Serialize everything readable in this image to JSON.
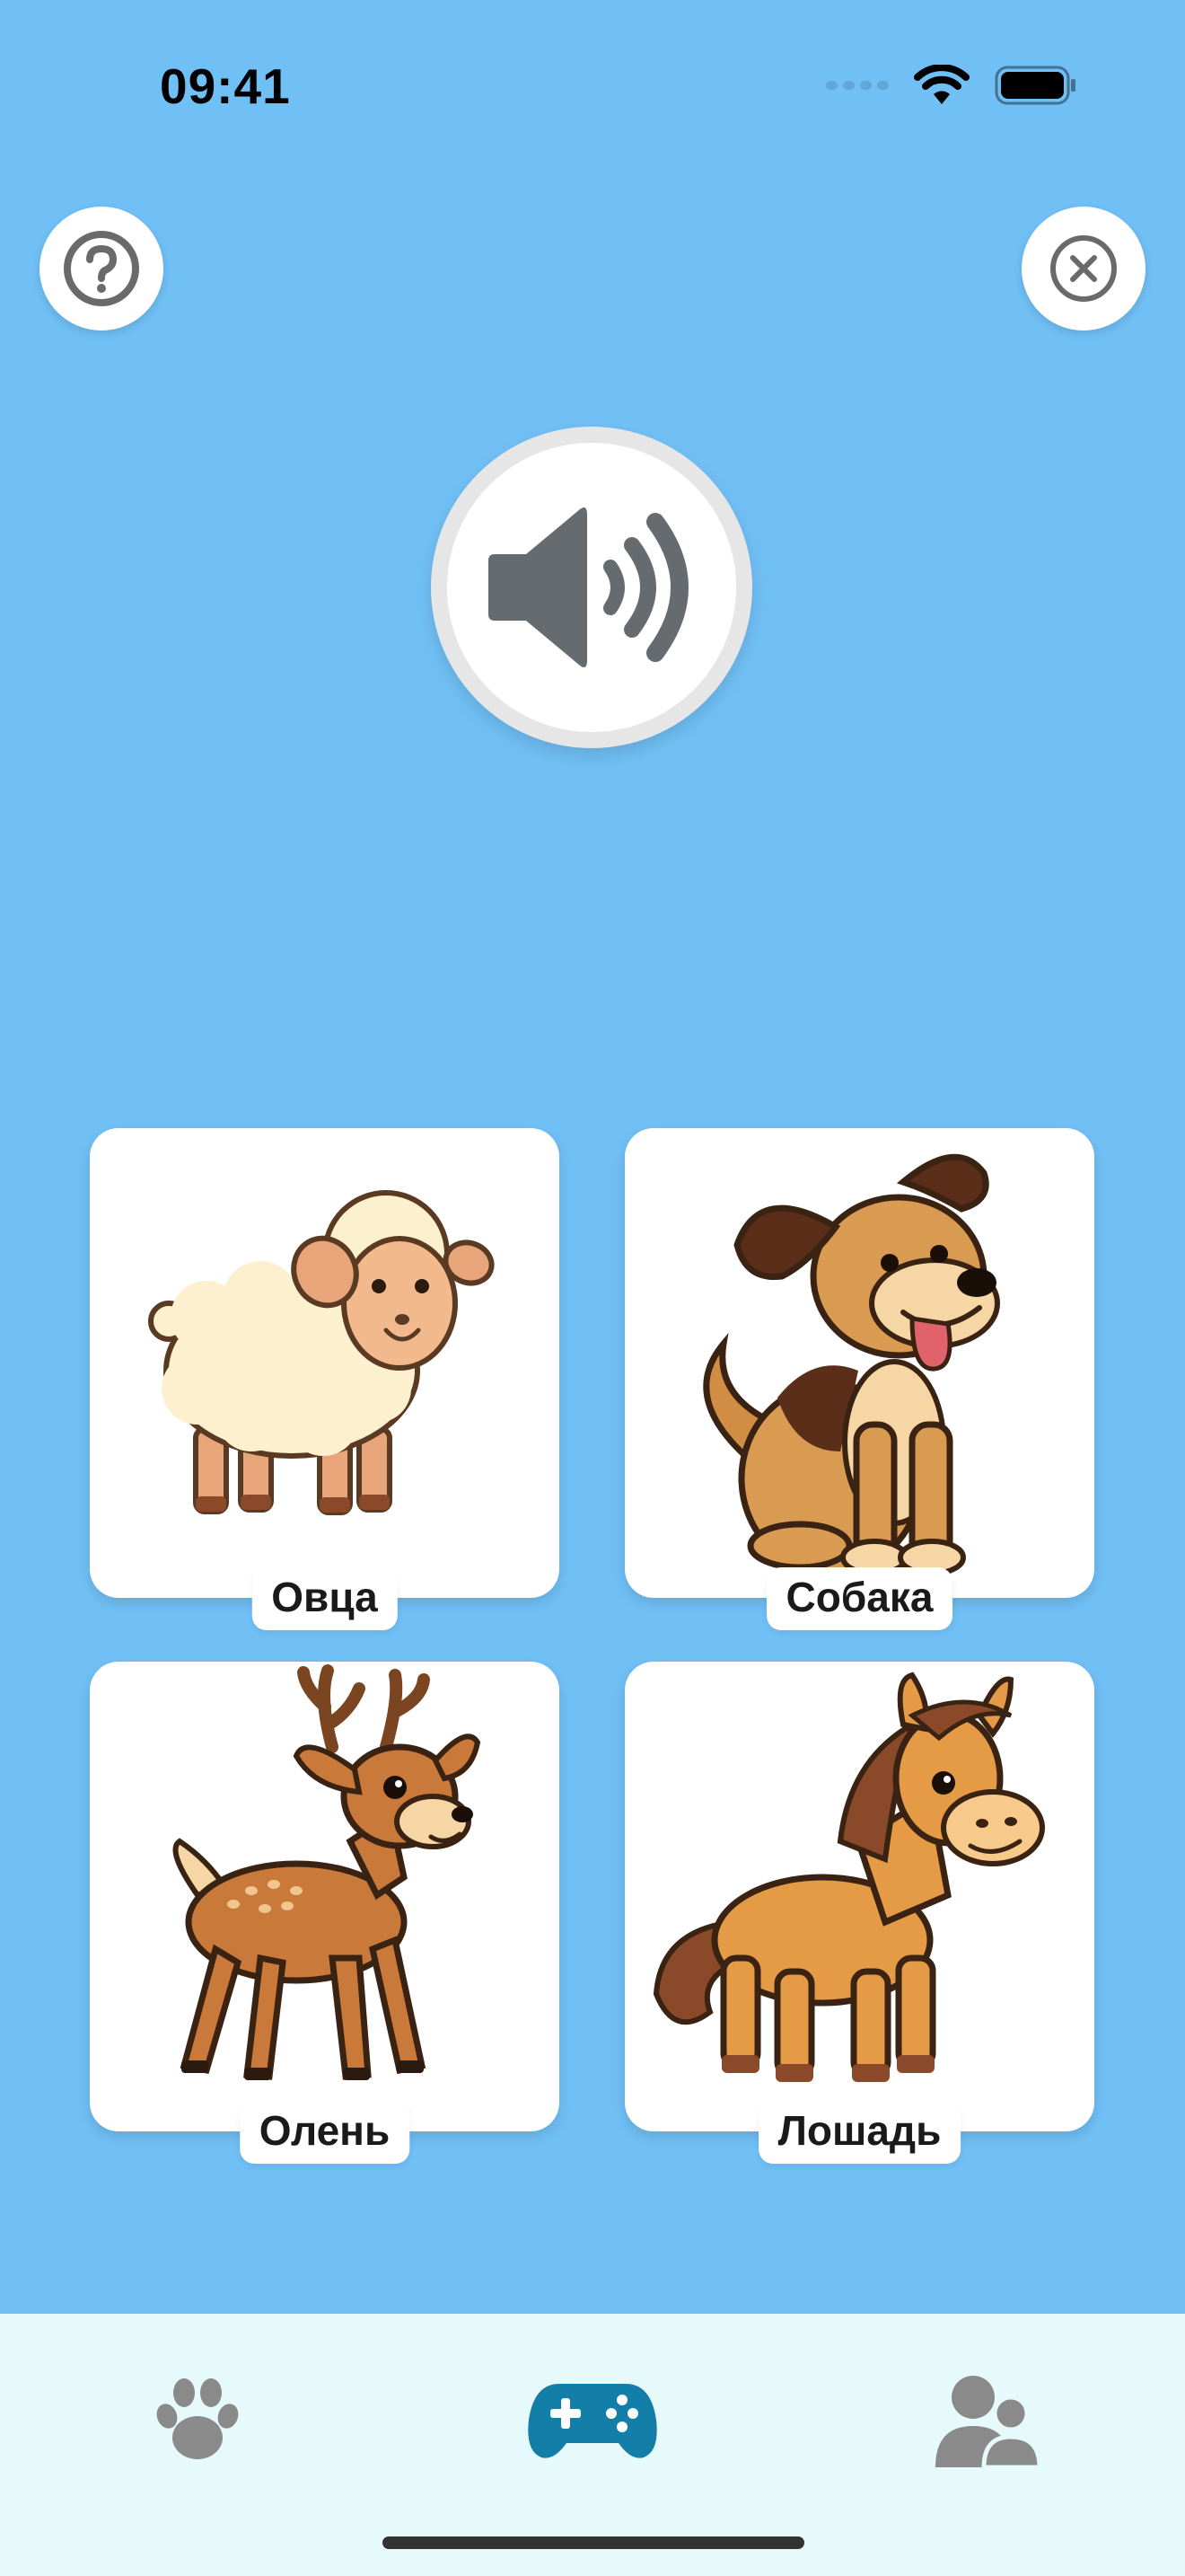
{
  "status_bar": {
    "time": "09:41"
  },
  "top_bar": {
    "help_icon": "question-circle-icon",
    "close_icon": "close-circle-icon"
  },
  "sound_button": {
    "icon": "speaker-icon"
  },
  "cards": [
    {
      "label": "Овца",
      "icon": "sheep-illustration"
    },
    {
      "label": "Собака",
      "icon": "dog-illustration"
    },
    {
      "label": "Олень",
      "icon": "deer-illustration"
    },
    {
      "label": "Лошадь",
      "icon": "horse-illustration"
    }
  ],
  "tab_bar": {
    "tabs": [
      {
        "icon": "paw-icon",
        "selected": false
      },
      {
        "icon": "gamepad-icon",
        "selected": true
      },
      {
        "icon": "profile-icon",
        "selected": false
      }
    ],
    "colors": {
      "active": "#137fa8",
      "inactive": "#8a8a8a"
    }
  },
  "colors": {
    "background": "#70bff5",
    "card": "#ffffff"
  }
}
